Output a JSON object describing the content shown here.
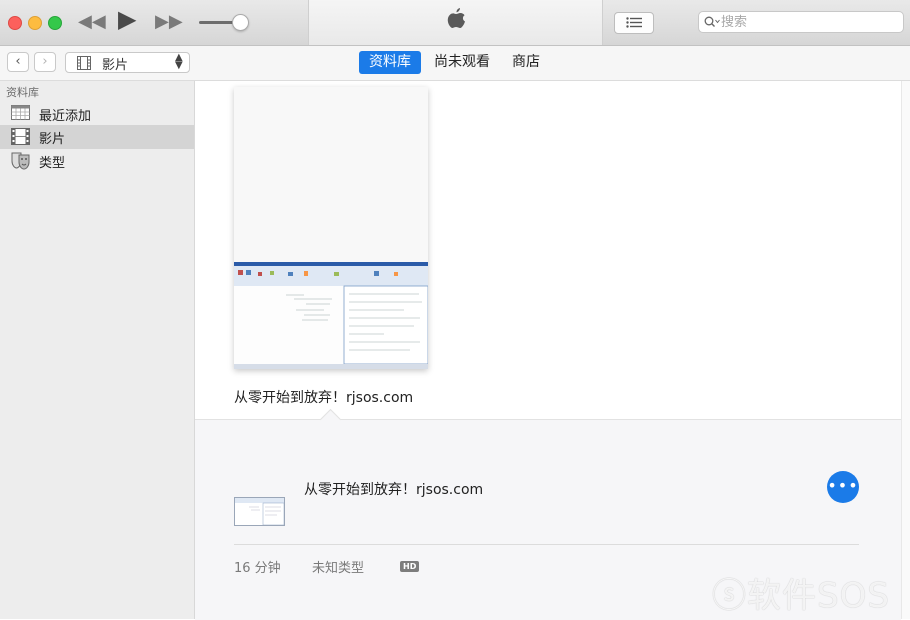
{
  "toolbar": {
    "search_placeholder": "搜索",
    "volume_level": 0.75
  },
  "navbar": {
    "media_kind": "影片",
    "tabs": [
      {
        "label": "资料库",
        "active": true
      },
      {
        "label": "尚未观看",
        "active": false
      },
      {
        "label": "商店",
        "active": false
      }
    ]
  },
  "sidebar": {
    "header": "资料库",
    "items": [
      {
        "label": "最近添加",
        "icon": "calendar-grid-icon",
        "selected": false
      },
      {
        "label": "影片",
        "icon": "film-strip-icon",
        "selected": true
      },
      {
        "label": "类型",
        "icon": "theater-masks-icon",
        "selected": false
      }
    ]
  },
  "library": {
    "movie_title": "从零开始到放弃！rjsos.com"
  },
  "detail": {
    "title": "从零开始到放弃！rjsos.com",
    "duration": "16 分钟",
    "genre": "未知类型",
    "badge": "HD"
  },
  "watermark": "软件SOS",
  "colors": {
    "accent": "#1b7be8",
    "sidebar_bg": "#ededed",
    "selected_row": "#d4d4d4"
  }
}
